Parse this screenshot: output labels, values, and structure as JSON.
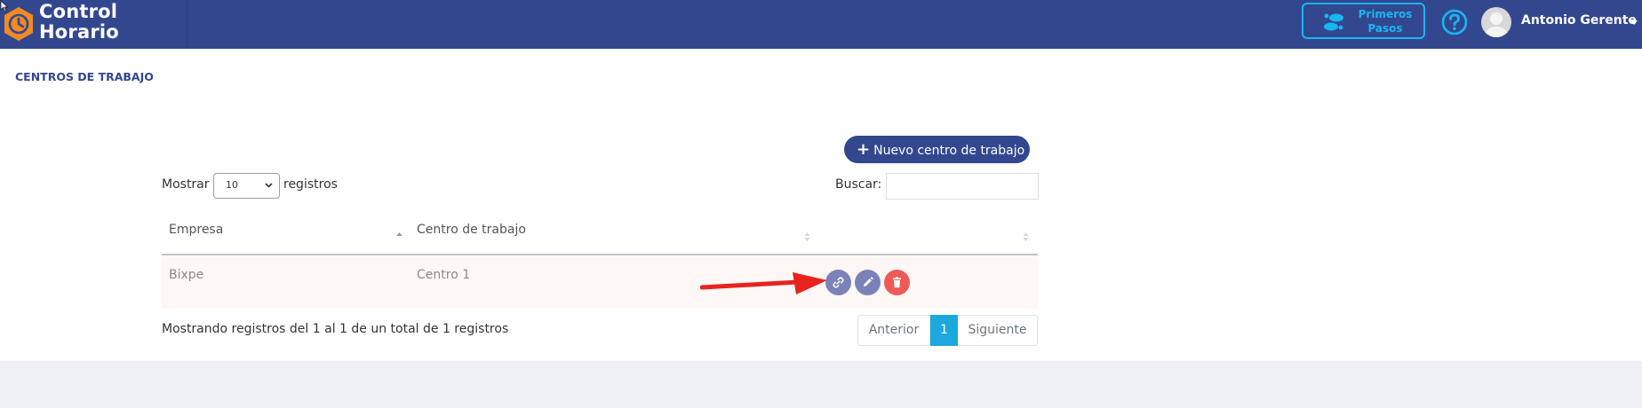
{
  "header": {
    "brand_line1": "Control",
    "brand_line2": "Horario",
    "first_steps_line1": "Primeros",
    "first_steps_line2": "Pasos",
    "user_name": "Antonio Gerente"
  },
  "page": {
    "title": "CENTROS DE TRABAJO",
    "new_button_label": "Nuevo centro de trabajo"
  },
  "table_controls": {
    "show_label": "Mostrar",
    "page_size": "10",
    "records_label": "registros",
    "search_label": "Buscar:",
    "search_value": ""
  },
  "table": {
    "columns": [
      "Empresa",
      "Centro de trabajo",
      ""
    ],
    "rows": [
      {
        "empresa": "Bixpe",
        "centro": "Centro 1"
      }
    ]
  },
  "footer": {
    "info": "Mostrando registros del 1 al 1 de un total de 1 registros",
    "prev_label": "Anterior",
    "current_page": "1",
    "next_label": "Siguiente"
  },
  "colors": {
    "navbar": "#33478f",
    "accent_blue": "#18b6f2",
    "link_button": "#7b82b8",
    "edit_button": "#7b82b8",
    "delete_button": "#ee5b57",
    "pager_active": "#1ba8dd",
    "annotation_arrow": "#e8231f"
  },
  "icons": {
    "logo": "clock-hexagon-icon",
    "first_steps": "footprints-icon",
    "help": "question-circle-icon",
    "link_action": "link-icon",
    "edit_action": "pencil-icon",
    "delete_action": "trash-icon"
  }
}
